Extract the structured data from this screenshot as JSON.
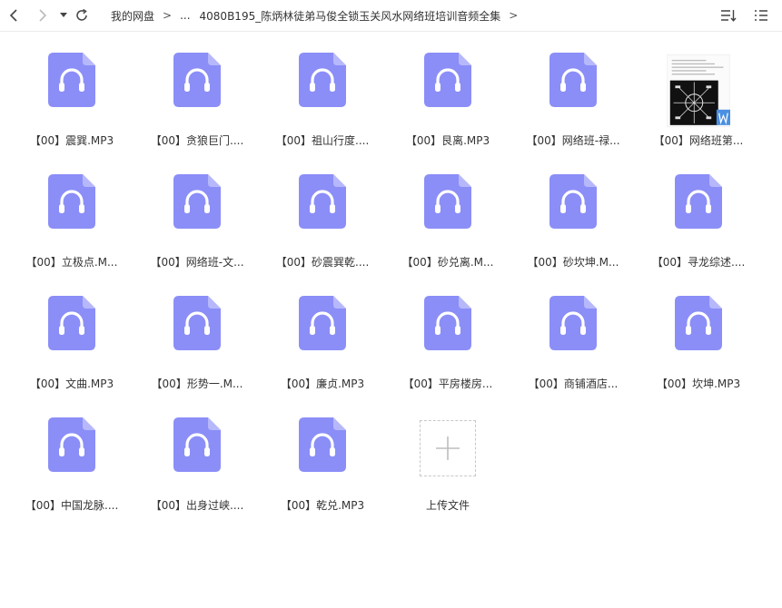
{
  "breadcrumb": {
    "root": "我的网盘",
    "ellipsis": "...",
    "current": "4080B195_陈炳林徒弟马俊全锁玉关风水网络班培训音频全集",
    "sep": ">"
  },
  "icons": {
    "back": "chevron-left-icon",
    "forward": "chevron-right-icon",
    "dropdown": "caret-down-icon",
    "refresh": "refresh-icon",
    "sort": "sort-icon",
    "list": "list-view-icon",
    "audio": "headphones-icon",
    "doc": "word-document-icon",
    "upload": "plus-icon"
  },
  "colors": {
    "audio_icon": "#8b8ef7",
    "doc_badge": "#4a90e2"
  },
  "files": [
    {
      "name": "【00】震巽.MP3",
      "type": "audio"
    },
    {
      "name": "【00】贪狼巨门....",
      "type": "audio"
    },
    {
      "name": "【00】祖山行度....",
      "type": "audio"
    },
    {
      "name": "【00】艮离.MP3",
      "type": "audio"
    },
    {
      "name": "【00】网络班-禄...",
      "type": "audio"
    },
    {
      "name": "【00】网络班第...",
      "type": "doc"
    },
    {
      "name": "【00】立极点.M...",
      "type": "audio"
    },
    {
      "name": "【00】网络班-文...",
      "type": "audio"
    },
    {
      "name": "【00】砂震巽乾....",
      "type": "audio"
    },
    {
      "name": "【00】砂兑离.M...",
      "type": "audio"
    },
    {
      "name": "【00】砂坎坤.M...",
      "type": "audio"
    },
    {
      "name": "【00】寻龙综述....",
      "type": "audio"
    },
    {
      "name": "【00】文曲.MP3",
      "type": "audio"
    },
    {
      "name": "【00】形势一.M...",
      "type": "audio"
    },
    {
      "name": "【00】廉贞.MP3",
      "type": "audio"
    },
    {
      "name": "【00】平房楼房...",
      "type": "audio"
    },
    {
      "name": "【00】商铺酒店...",
      "type": "audio"
    },
    {
      "name": "【00】坎坤.MP3",
      "type": "audio"
    },
    {
      "name": "【00】中国龙脉....",
      "type": "audio"
    },
    {
      "name": "【00】出身过峡....",
      "type": "audio"
    },
    {
      "name": "【00】乾兑.MP3",
      "type": "audio"
    }
  ],
  "upload": {
    "label": "上传文件"
  }
}
